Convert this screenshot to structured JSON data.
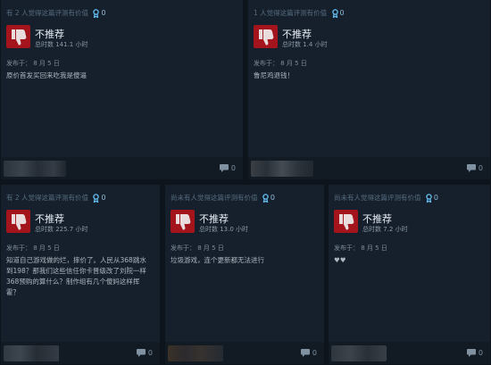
{
  "reviews": [
    {
      "helpful": "有 2 人觉得这篇评测有价值",
      "award_count": "0",
      "verdict": "不推荐",
      "hours": "总时数 141.1 小时",
      "posted": "发布于： 8 月 5 日",
      "content": "原价首发买回来吃我是傻逼",
      "comments": "0"
    },
    {
      "helpful": "1 人觉得这篇评测有价值",
      "award_count": "0",
      "verdict": "不推荐",
      "hours": "总时数 1.4 小时",
      "posted": "发布于： 8 月 5 日",
      "content": "鲁尼鸡退钱！",
      "comments": "0"
    },
    {
      "helpful": "有 2 人觉得这篇评测有价值",
      "award_count": "0",
      "verdict": "不推荐",
      "hours": "总时数 225.7 小时",
      "posted": "发布于： 8 月 5 日",
      "content": "知道自己游戏做的烂，摔价了。人民从368跳水到198？那我们这些信任你卡晋级改了刘院一样368预购的算什么？制作组有几个傻妈这样挥霍？",
      "comments": "0"
    },
    {
      "helpful": "尚未有人觉得这篇评测有价值",
      "award_count": "0",
      "verdict": "不推荐",
      "hours": "总时数 13.0 小时",
      "posted": "发布于： 8 月 5 日",
      "content": "垃圾游戏，连个更新都无法进行",
      "comments": "0"
    },
    {
      "helpful": "尚未有人觉得这篇评测有价值",
      "award_count": "0",
      "verdict": "不推荐",
      "hours": "总时数 7.2 小时",
      "posted": "发布于： 8 月 5 日",
      "content": "♥♥",
      "comments": "0"
    }
  ],
  "icons": {
    "thumb": "thumbs-down-icon",
    "award": "award-ribbon-icon",
    "comment": "comment-bubble-icon"
  },
  "colors": {
    "card": "#16202d",
    "thumb_bg": "#a3141c",
    "award": "#66c0f4"
  }
}
